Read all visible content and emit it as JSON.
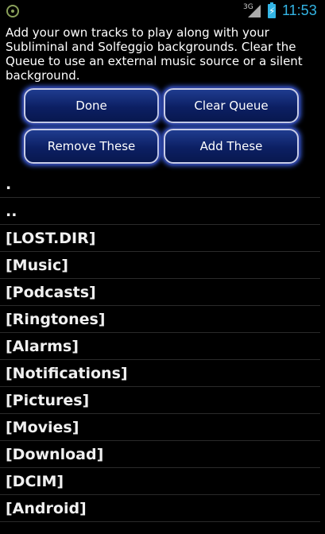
{
  "status_bar": {
    "network": "3G",
    "time": "11:53",
    "colors": {
      "accent": "#33b5e5"
    },
    "icons": [
      "app-indicator-icon",
      "signal-icon",
      "battery-charging-icon"
    ]
  },
  "instructions": "Add your own tracks to play along with your Subliminal and Solfeggio backgrounds.  Clear the Queue to use an external music source or a silent background.",
  "buttons": {
    "done": "Done",
    "clear_queue": "Clear Queue",
    "remove_these": "Remove These",
    "add_these": "Add These"
  },
  "files": [
    ".",
    "..",
    "[LOST.DIR]",
    "[Music]",
    "[Podcasts]",
    "[Ringtones]",
    "[Alarms]",
    "[Notifications]",
    "[Pictures]",
    "[Movies]",
    "[Download]",
    "[DCIM]",
    "[Android]"
  ]
}
